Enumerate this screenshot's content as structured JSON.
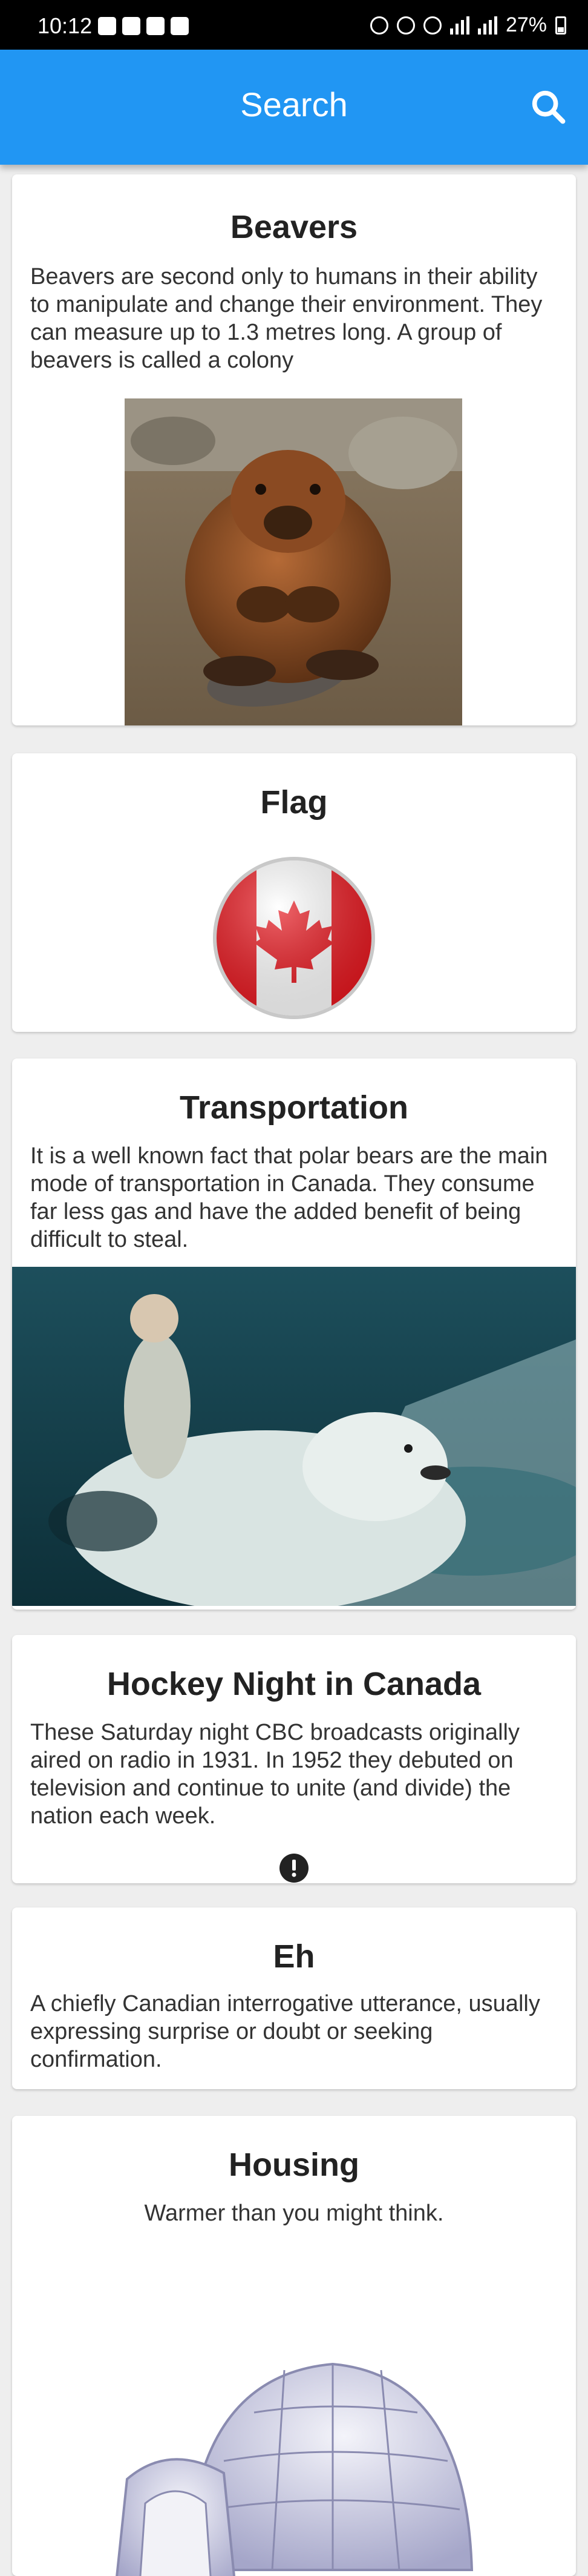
{
  "status_bar": {
    "time": "10:12",
    "battery": "27%"
  },
  "app_bar": {
    "title": "Search",
    "search_icon": "search-icon"
  },
  "cards": [
    {
      "title": "Beavers",
      "text": "Beavers are second only to humans in their ability to manipulate and change their environment. They can measure up to 1.3 metres long. A group of beavers is called a colony",
      "image": "beaver-photo"
    },
    {
      "title": "Flag",
      "image": "canada-flag-button"
    },
    {
      "title": "Transportation",
      "text": "It is a well known fact that polar bears are the main mode of transportation in Canada. They consume far less gas and have the added benefit of being difficult to steal.",
      "image": "polar-bear-rider-photo"
    },
    {
      "title": "Hockey Night in Canada",
      "text": "These Saturday night CBC broadcasts originally aired on radio in 1931. In 1952 they debuted on television and continue to unite (and divide) the nation each week.",
      "icon": "alert-icon"
    },
    {
      "title": "Eh",
      "text": "A chiefly Canadian interrogative utterance, usually expressing surprise or doubt or seeking confirmation."
    },
    {
      "title": "Housing",
      "text": "Warmer than you might think.",
      "image": "igloo-illustration"
    }
  ],
  "colors": {
    "app_bar": "#2196f3",
    "background": "#eeeeee",
    "card": "#ffffff",
    "flag_red": "#e8141c"
  }
}
